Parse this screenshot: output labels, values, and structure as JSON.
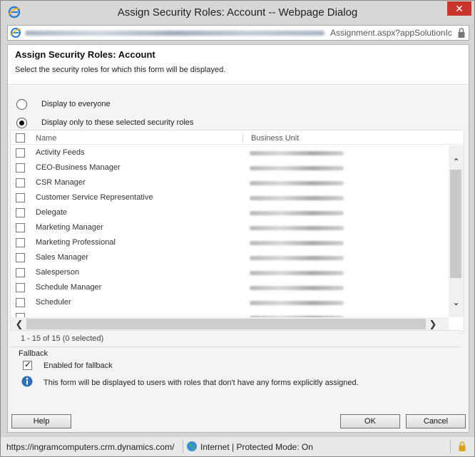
{
  "window": {
    "title": "Assign Security Roles: Account -- Webpage Dialog",
    "close_glyph": "✕"
  },
  "address": {
    "url_visible": "Assignment.aspx?appSolutionIc"
  },
  "dialog": {
    "title": "Assign Security Roles: Account",
    "description": "Select the security roles for which this form will be displayed."
  },
  "options": {
    "everyone_label": "Display to everyone",
    "selected_label": "Display only to these selected security roles",
    "selected_option": "selected"
  },
  "grid": {
    "columns": {
      "name": "Name",
      "business_unit": "Business Unit"
    },
    "rows": [
      {
        "name": "Activity Feeds"
      },
      {
        "name": "CEO-Business Manager"
      },
      {
        "name": "CSR Manager"
      },
      {
        "name": "Customer Service Representative"
      },
      {
        "name": "Delegate"
      },
      {
        "name": "Marketing Manager"
      },
      {
        "name": "Marketing Professional"
      },
      {
        "name": "Sales Manager"
      },
      {
        "name": "Salesperson"
      },
      {
        "name": "Schedule Manager"
      },
      {
        "name": "Scheduler"
      },
      {
        "name": ""
      }
    ],
    "record_count": "1 - 15 of 15 (0 selected)",
    "scroll_up_glyph": "⌃",
    "scroll_down_glyph": "⌄",
    "scroll_left_glyph": "❮",
    "scroll_right_glyph": "❯"
  },
  "fallback": {
    "legend": "Fallback",
    "enabled_label": "Enabled for fallback",
    "enabled": true,
    "info_text": "This form will be displayed to users with roles that don't have any forms explicitly assigned."
  },
  "buttons": {
    "help": "Help",
    "ok": "OK",
    "cancel": "Cancel"
  },
  "status": {
    "host": "https://ingramcomputers.crm.dynamics.com/",
    "zone": "Internet | Protected Mode: On"
  },
  "colors": {
    "close_button": "#c7352b",
    "content_bg": "#f4f4f4"
  }
}
